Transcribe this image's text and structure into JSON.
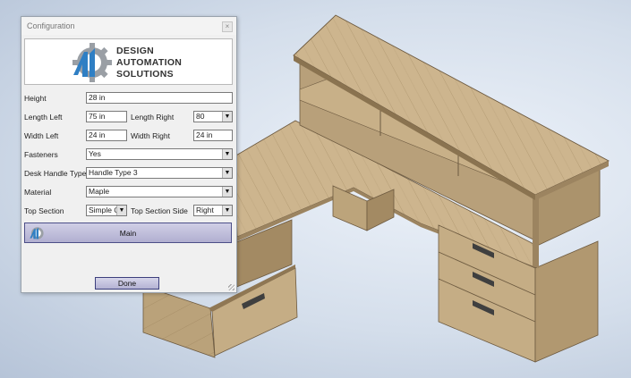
{
  "dialog": {
    "title": "Configuration",
    "close_glyph": "×",
    "logo": {
      "line1": "DESIGN",
      "line2": "AUTOMATION",
      "line3": "SOLUTIONS"
    },
    "fields": {
      "height": {
        "label": "Height",
        "value": "28 in"
      },
      "length_left": {
        "label": "Length Left",
        "value": "75 in"
      },
      "length_right": {
        "label": "Length Right",
        "value": "80"
      },
      "width_left": {
        "label": "Width Left",
        "value": "24 in"
      },
      "width_right": {
        "label": "Width Right",
        "value": "24 in"
      },
      "fasteners": {
        "label": "Fasteners",
        "value": "Yes"
      },
      "desk_handle_type": {
        "label": "Desk Handle Type",
        "value": "Handle Type 3"
      },
      "material": {
        "label": "Material",
        "value": "Maple"
      },
      "top_section": {
        "label": "Top Section",
        "value": "Simple Q"
      },
      "top_section_side": {
        "label": "Top Section Side",
        "value": "Right"
      }
    },
    "main_button": "Main",
    "done_button": "Done"
  },
  "colors": {
    "wood_top": "#cdb58e",
    "wood_side": "#b79f77",
    "wood_dark": "#a38a63",
    "button_fill": "#c1c0dc",
    "button_border": "#4c4f88",
    "gear_blue": "#2f7fc4",
    "gear_gray": "#9a9fa5"
  },
  "icons": {
    "logo": "gear-logo-icon",
    "close": "close-icon",
    "dropdown": "chevron-down-icon",
    "main": "gear-logo-icon"
  }
}
